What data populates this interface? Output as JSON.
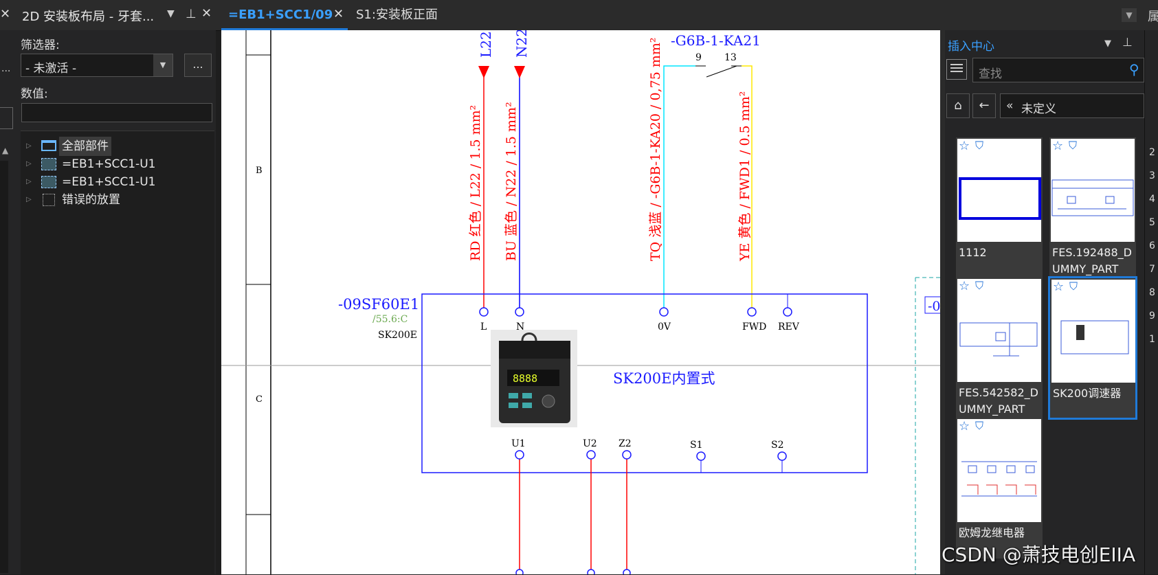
{
  "left_stub": {
    "close_glyph": "✕",
    "dots": "..."
  },
  "filter_panel": {
    "title": "2D 安装板布局 - 牙套...",
    "filter_label": "筛选器:",
    "filter_value": "- 未激活 -",
    "more_button": "...",
    "value_label": "数值:",
    "value_input": "",
    "tree": [
      {
        "label": "全部部件",
        "icon": "folder-icon"
      },
      {
        "label": "=EB1+SCC1-U1",
        "icon": "assembly-icon"
      },
      {
        "label": "=EB1+SCC1-U1",
        "icon": "assembly-icon"
      },
      {
        "label": "错误的放置",
        "icon": "placement-icon"
      }
    ]
  },
  "tabs": [
    {
      "label": "=EB1+SCC1/09",
      "active": true
    },
    {
      "label": "S1:安装板正面",
      "active": false
    }
  ],
  "schematic": {
    "row_b": "B",
    "row_c": "C",
    "wire_l_top": "L22",
    "wire_n_top": "N22",
    "wire_l_label": "RD 红色 / L22 / 1.5 mm²",
    "wire_n_label": "BU 蓝色 / N22 / 1.5 mm²",
    "wire_tq_label": "TQ 浅蓝 / -G6B-1-KA20 / 0,75 mm²",
    "wire_ye_label": "YE 黄色 / FWD1 / 0.5 mm²",
    "relay_tag": "-G6B-1-KA21",
    "relay_pin_a": "9",
    "relay_pin_b": "13",
    "device_tag": "-09SF60E1",
    "device_ref": "/55.6:C",
    "device_type": "SK200E",
    "device_name": "SK200E内置式",
    "terminals_top": [
      "L",
      "N",
      "0V",
      "FWD",
      "REV"
    ],
    "terminals_bottom": [
      "U1",
      "U2",
      "Z2",
      "S1",
      "S2"
    ],
    "display_digits": "8888",
    "edge_label": "-0"
  },
  "insert_center": {
    "title": "插入中心",
    "search_placeholder": "查找",
    "breadcrumb_prefix": "«",
    "breadcrumb": "未定义",
    "items": [
      {
        "label": "1112",
        "selected": false
      },
      {
        "label": "FES.192488_DUMMY_PART",
        "selected": false
      },
      {
        "label": "FES.542582_DUMMY_PART",
        "selected": false
      },
      {
        "label": "SK200调速器",
        "selected": true
      },
      {
        "label": "欧姆龙继电器",
        "selected": false
      }
    ]
  },
  "right_edge_numbers": [
    "2",
    "3",
    "4",
    "5",
    "6",
    "7",
    "8",
    "9",
    "1"
  ],
  "watermark": "CSDN @萧技电创EIIA",
  "colors": {
    "accent": "#1f7ad8",
    "wire_red": "#ff0000",
    "wire_blue": "#0000ff",
    "wire_cyan": "#00e5ff",
    "wire_yellow": "#ffe800",
    "schematic_blue": "#1a1aff"
  }
}
